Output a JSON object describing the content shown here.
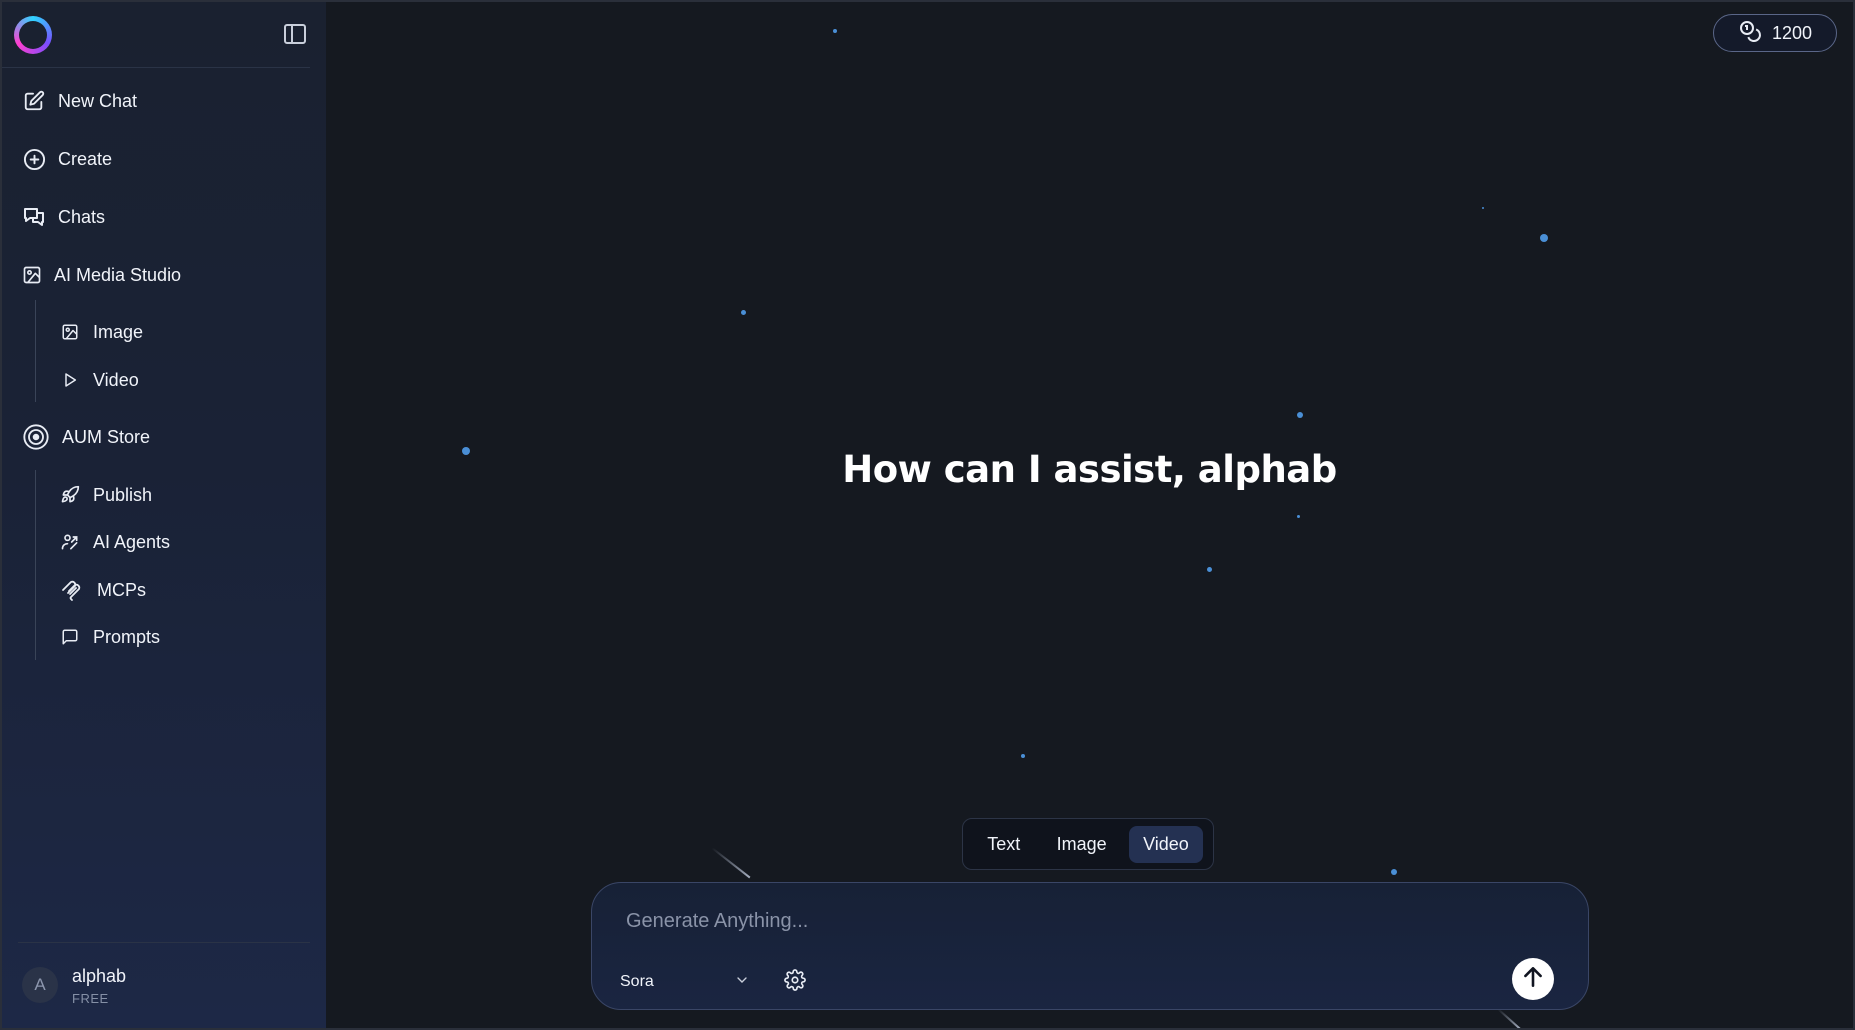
{
  "sidebar": {
    "nav": {
      "new_chat": "New Chat",
      "create": "Create",
      "chats": "Chats",
      "ai_media_studio": "AI Media Studio",
      "image": "Image",
      "video": "Video",
      "aum_store": "AUM Store",
      "publish": "Publish",
      "ai_agents": "AI Agents",
      "mcps": "MCPs",
      "prompts": "Prompts"
    },
    "user": {
      "initial": "A",
      "name": "alphab",
      "plan": "FREE"
    }
  },
  "header": {
    "credits": "1200"
  },
  "main": {
    "greeting": "How can I assist, alphab",
    "modes": [
      "Text",
      "Image",
      "Video"
    ],
    "active_mode": "Video"
  },
  "composer": {
    "placeholder": "Generate Anything...",
    "model": "Sora"
  },
  "colors": {
    "star": "#4a8fd6",
    "active_mode_bg": "#243152",
    "sidebar_bg": "#1a2236",
    "main_bg": "#151920"
  },
  "icons": {
    "logo": "logo-ring",
    "toggle": "sidebar-toggle-icon",
    "new_chat": "edit-icon",
    "create": "plus-circle-icon",
    "chats": "chat-bubbles-icon",
    "ai_media_studio": "media-icon",
    "image": "image-icon",
    "video": "play-icon",
    "aum_store": "target-icon",
    "publish": "rocket-icon",
    "ai_agents": "agent-icon",
    "mcps": "mcp-icon",
    "prompts": "message-square-icon",
    "credits": "coins-icon",
    "settings": "gear-icon",
    "send": "arrow-up-icon",
    "dropdown": "chevron-down-icon"
  }
}
